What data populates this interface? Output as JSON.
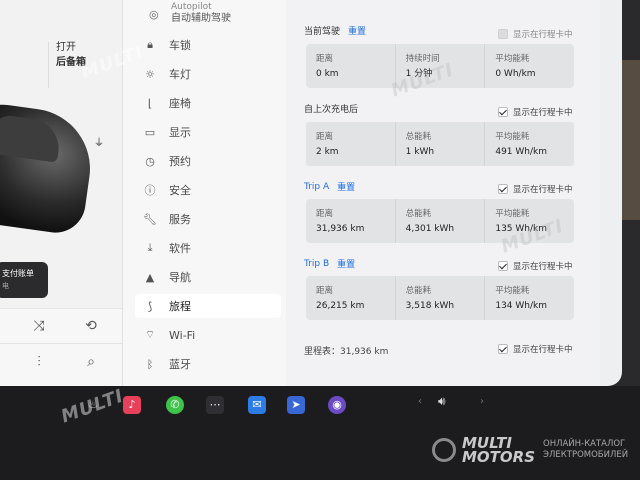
{
  "left_panel": {
    "trunk_open": "打开",
    "trunk_label": "后备箱",
    "bill_title": "支付账单",
    "bill_sub": "电"
  },
  "sidebar": {
    "top_item": {
      "en": "Autopilot",
      "zh": "自动辅助驾驶"
    },
    "items": [
      {
        "label": "车锁",
        "icon": "lock-icon"
      },
      {
        "label": "车灯",
        "icon": "light-icon"
      },
      {
        "label": "座椅",
        "icon": "seat-icon"
      },
      {
        "label": "显示",
        "icon": "display-icon"
      },
      {
        "label": "预约",
        "icon": "clock-icon"
      },
      {
        "label": "安全",
        "icon": "info-icon"
      },
      {
        "label": "服务",
        "icon": "wrench-icon"
      },
      {
        "label": "软件",
        "icon": "download-icon"
      },
      {
        "label": "导航",
        "icon": "navigation-icon"
      },
      {
        "label": "旅程",
        "icon": "trip-icon",
        "active": true
      },
      {
        "label": "Wi-Fi",
        "icon": "wifi-icon"
      },
      {
        "label": "蓝牙",
        "icon": "bluetooth-icon"
      }
    ]
  },
  "trips": {
    "show_label": "显示在行程卡中",
    "reset_label": "重置",
    "sections": [
      {
        "title": "当前驾驶",
        "has_reset": true,
        "show_checked": false,
        "cells": [
          {
            "label": "距离",
            "value": "0 km"
          },
          {
            "label": "持续时间",
            "value": "1 分钟"
          },
          {
            "label": "平均能耗",
            "value": "0 Wh/km"
          }
        ]
      },
      {
        "title": "自上次充电后",
        "has_reset": false,
        "show_checked": true,
        "cells": [
          {
            "label": "距离",
            "value": "2 km"
          },
          {
            "label": "总能耗",
            "value": "1 kWh"
          },
          {
            "label": "平均能耗",
            "value": "491 Wh/km"
          }
        ]
      },
      {
        "title": "Trip A",
        "has_reset": true,
        "show_checked": true,
        "cells": [
          {
            "label": "距离",
            "value": "31,936 km"
          },
          {
            "label": "总能耗",
            "value": "4,301 kWh"
          },
          {
            "label": "平均能耗",
            "value": "135 Wh/km"
          }
        ]
      },
      {
        "title": "Trip B",
        "has_reset": true,
        "show_checked": true,
        "cells": [
          {
            "label": "距离",
            "value": "26,215 km"
          },
          {
            "label": "总能耗",
            "value": "3,518 kWh"
          },
          {
            "label": "平均能耗",
            "value": "134 Wh/km"
          }
        ]
      }
    ],
    "odometer": "里程表：31,936 km",
    "odometer_checked": true
  },
  "dock": {
    "items": [
      "heater-icon",
      "music-icon",
      "phone-icon",
      "more-icon",
      "messages-icon",
      "nav-app-icon",
      "camera-icon"
    ],
    "colors": {
      "music": "#e8405a",
      "phone": "#3ec24a",
      "messages": "#2d7be5",
      "nav": "#3a67d6",
      "camera": "#6b4bc4"
    }
  },
  "watermark": {
    "brand_line1": "MULTI",
    "brand_line2": "MOTORS",
    "tagline1": "ОНЛАЙН-КАТАЛОГ",
    "tagline2": "ЭЛЕКТРОМОБИЛЕЙ"
  }
}
